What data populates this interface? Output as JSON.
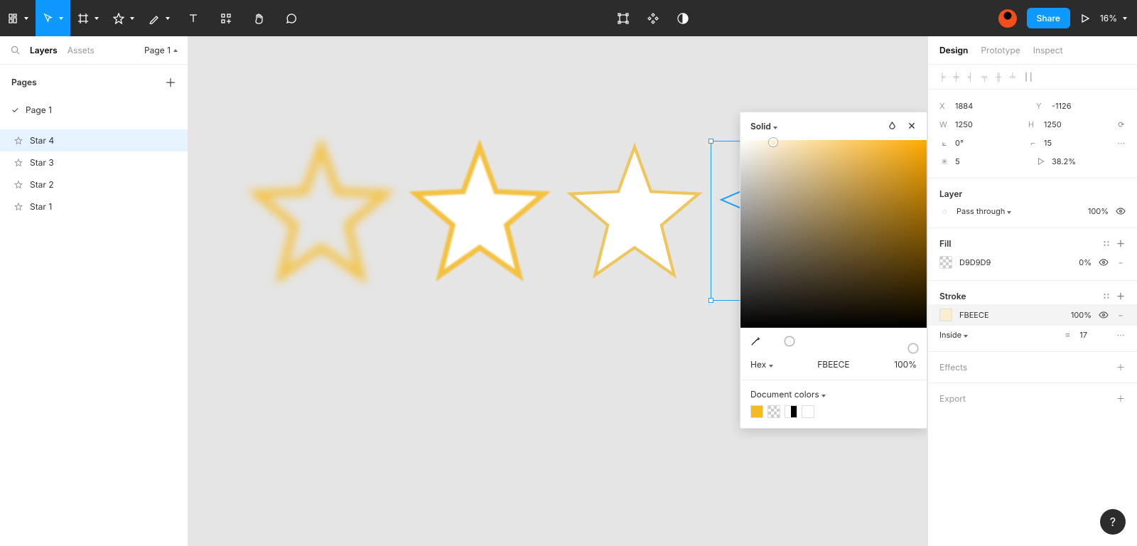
{
  "toolbar": {
    "share_label": "Share",
    "zoom": "16%"
  },
  "left": {
    "tab_layers": "Layers",
    "tab_assets": "Assets",
    "page_selector": "Page 1",
    "pages_label": "Pages",
    "page_name": "Page 1",
    "layers": [
      {
        "name": "Star 4",
        "selected": true
      },
      {
        "name": "Star 3",
        "selected": false
      },
      {
        "name": "Star 2",
        "selected": false
      },
      {
        "name": "Star 1",
        "selected": false
      }
    ]
  },
  "right": {
    "tab_design": "Design",
    "tab_prototype": "Prototype",
    "tab_inspect": "Inspect",
    "x": "1884",
    "y": "-1126",
    "w": "1250",
    "h": "1250",
    "rotation": "0°",
    "corner": "15",
    "points": "5",
    "ratio": "38.2%",
    "layer_label": "Layer",
    "blend": "Pass through",
    "opacity": "100%",
    "fill_label": "Fill",
    "fill_hex": "D9D9D9",
    "fill_opacity": "0%",
    "stroke_label": "Stroke",
    "stroke_hex": "FBEECE",
    "stroke_opacity": "100%",
    "stroke_pos": "Inside",
    "stroke_w": "17",
    "effects_label": "Effects",
    "export_label": "Export"
  },
  "picker": {
    "mode": "Solid",
    "format": "Hex",
    "hex": "FBEECE",
    "alpha": "100%",
    "doc_colors_label": "Document colors"
  },
  "help": "?"
}
